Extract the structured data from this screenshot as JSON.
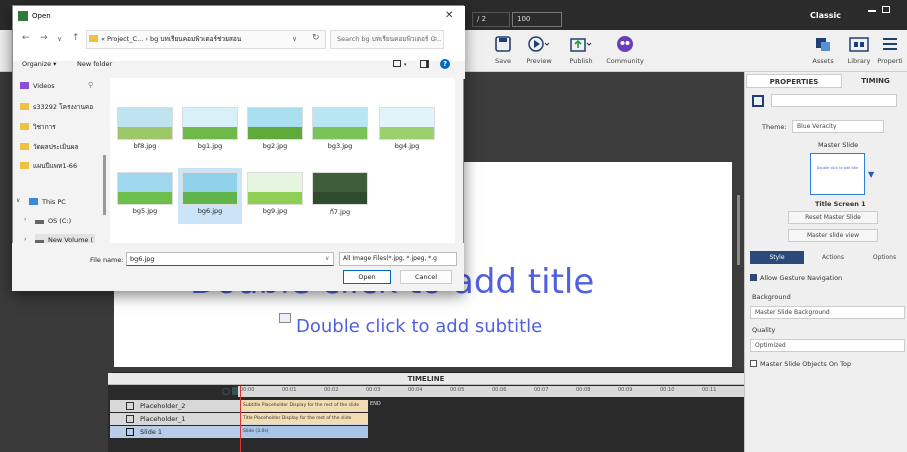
{
  "app": {
    "page_indicator": "/ 2",
    "zoom": "100",
    "mode_label": "Classic",
    "tools": [
      {
        "label": "Save",
        "icon": "save-icon"
      },
      {
        "label": "Preview",
        "icon": "preview-icon"
      },
      {
        "label": "Publish",
        "icon": "publish-icon"
      },
      {
        "label": "Community",
        "icon": "community-icon"
      }
    ],
    "right_tools": [
      {
        "label": "Assets",
        "icon": "assets-icon"
      },
      {
        "label": "Library",
        "icon": "library-icon"
      },
      {
        "label": "Properti",
        "icon": "properties-icon"
      }
    ]
  },
  "slide": {
    "title": "Double click to add title",
    "subtitle": "Double click to add subtitle"
  },
  "timeline": {
    "header": "TIMELINE",
    "ruler": [
      "00:00",
      "00:01",
      "00:02",
      "00:03",
      "00:04",
      "00:05",
      "00:06",
      "00:07",
      "00:08",
      "00:09",
      "00:10",
      "00:11"
    ],
    "end_label": "END",
    "rows": [
      {
        "label": "Placeholder_2",
        "bar": "Subtitle Placeholder Display for the rest of the slide"
      },
      {
        "label": "Placeholder_1",
        "bar": "Title Placeholder Display for the rest of the slide"
      },
      {
        "label": "Slide 1",
        "bar": "Slide (3.0s)"
      }
    ]
  },
  "properties": {
    "tab_properties": "PROPERTIES",
    "tab_timing": "TIMING",
    "theme_label": "Theme:",
    "theme_value": "Blue Veracity",
    "master_slide_label": "Master Slide",
    "thumb_text": "Double click to add title",
    "master_title": "Title Screen 1",
    "reset_btn": "Reset Master Slide",
    "view_btn": "Master slide view",
    "subtabs": [
      "Style",
      "Actions",
      "Options"
    ],
    "gesture_label": "Allow Gesture Navigation",
    "background_label": "Background",
    "background_value": "Master Slide Background",
    "quality_label": "Quality",
    "quality_value": "Optimized",
    "master_objects_label": "Master Slide Objects On Top"
  },
  "dialog": {
    "title": "Open",
    "close": "✕",
    "address": "« Project_C... › bg บทเรียนคอมพิวเตอร์ช่วยสอน",
    "search_placeholder": "Search bg บทเรียนคอมพิวเตอร์ C...",
    "organize": "Organize ▾",
    "new_folder": "New folder",
    "nav_items": [
      {
        "label": "Videos",
        "color": "#8a4fd8"
      },
      {
        "label": "s33292 โครงงานคอ",
        "color": "#f0c040"
      },
      {
        "label": "วิชาการ",
        "color": "#f0c040"
      },
      {
        "label": "วัดผลประเมินผล",
        "color": "#f0c040"
      },
      {
        "label": "แผนปีแพท1-66",
        "color": "#f0c040"
      }
    ],
    "nav_pc": [
      {
        "label": "This PC",
        "color": "#3b8ad9"
      },
      {
        "label": "OS (C:)",
        "color": "#666666"
      },
      {
        "label": "New Volume (",
        "color": "#666666"
      }
    ],
    "files": [
      {
        "name": "bf8.jpg",
        "sky": "#bfe4ef",
        "ground": "#9cc86a"
      },
      {
        "name": "bg1.jpg",
        "sky": "#d8f0f7",
        "ground": "#6fb84a"
      },
      {
        "name": "bg2.jpg",
        "sky": "#a9e0f0",
        "ground": "#5faa3a"
      },
      {
        "name": "bg3.jpg",
        "sky": "#b9e6f3",
        "ground": "#79c458"
      },
      {
        "name": "bg4.jpg",
        "sky": "#e0f4fa",
        "ground": "#9bd06e"
      },
      {
        "name": "bg5.jpg",
        "sky": "#9fd8ee",
        "ground": "#6cbf4b"
      },
      {
        "name": "bg6.jpg",
        "sky": "#8fd2ea",
        "ground": "#5fb54a"
      },
      {
        "name": "bg9.jpg",
        "sky": "#e6f5e0",
        "ground": "#8fcf55"
      },
      {
        "name": "ก้7.jpg",
        "sky": "#3f5d3a",
        "ground": "#2f4a2c"
      }
    ],
    "file_name_label": "File name:",
    "file_name_value": "bg6.jpg",
    "file_type": "All Image Files(*.jpg, *.jpeg, *.g",
    "open_btn": "Open",
    "cancel_btn": "Cancel"
  }
}
